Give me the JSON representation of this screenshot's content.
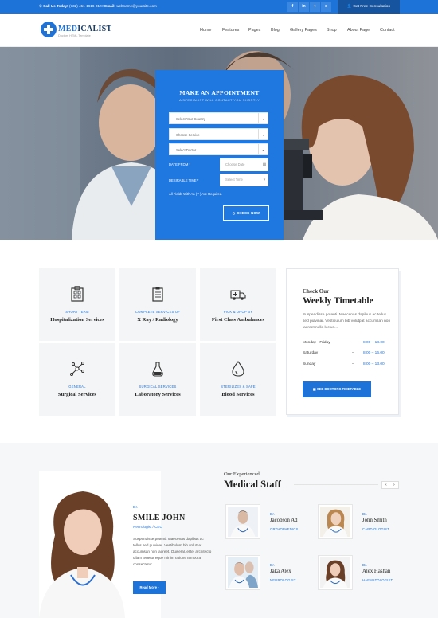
{
  "topbar": {
    "phone_label": "Call Us Today!",
    "phone": "(732) 451-1616-01",
    "email_label": "Email:",
    "email": "webname@yoursite.com",
    "social": [
      {
        "icon": "facebook-icon",
        "glyph": "f"
      },
      {
        "icon": "linkedin-icon",
        "glyph": "in"
      },
      {
        "icon": "twitter-icon",
        "glyph": "t"
      },
      {
        "icon": "skype-icon",
        "glyph": "s"
      }
    ],
    "cta": "Get Free Consultation"
  },
  "logo": {
    "part1": "MED",
    "part2": "ICALIST",
    "tagline": "Doctors HTML Template"
  },
  "nav": [
    "Home",
    "Features",
    "Pages",
    "Blog",
    "Gallery Pages",
    "Shop",
    "About Page",
    "Contact"
  ],
  "appointment": {
    "title": "MAKE AN APPOINTMENT",
    "subtitle": "A SPECIALIST WILL CONTACT YOU SHORTLY",
    "country_placeholder": "Select Your Country",
    "service_placeholder": "Choose Service",
    "doctor_placeholder": "Select Doctor",
    "date_label": "DATE FROM *",
    "date_placeholder": "Choose Date",
    "time_label": "DESIRABLE TIME *",
    "time_placeholder": "Select Time",
    "required_note": "All Fields With An ( * ) Are Required.",
    "submit": "CHECK NOW"
  },
  "services": [
    {
      "category": "SHORT TERM",
      "name": "Hospitalization Services",
      "icon": "hospital-icon"
    },
    {
      "category": "COMPLETE SERVICES OF",
      "name": "X Ray / Radiology",
      "icon": "clipboard-icon"
    },
    {
      "category": "PICK & DROP BY",
      "name": "First Class Ambulances",
      "icon": "ambulance-icon"
    },
    {
      "category": "GENERAL",
      "name": "Surgical Services",
      "icon": "molecule-icon"
    },
    {
      "category": "SURGICAL SERVICES",
      "name": "Laboratory Services",
      "icon": "flask-icon"
    },
    {
      "category": "STERILIZES & SAFE",
      "name": "Blood Services",
      "icon": "blood-drop-icon"
    }
  ],
  "timetable": {
    "pre": "Check Our",
    "title": "Weekly Timetable",
    "text": "Suspendisse potenti. Maecenas dapibus ac tellus sed pulvinar. Vestibulum bib volutpat accumsan non laoreet nulla luctus...",
    "rows": [
      {
        "day": "Monday - Friday",
        "dash": "–",
        "time": "8.00 – 18.00"
      },
      {
        "day": "Saturday",
        "dash": "–",
        "time": "8.00 – 16.00"
      },
      {
        "day": "Sunday",
        "dash": "–",
        "time": "8.00 – 13.00"
      }
    ],
    "button": "SEE DOCTORS TIMETABLE"
  },
  "featured_doctor": {
    "prefix": "Dr.",
    "name": "SMILE JOHN",
    "role": "Neurologist / CEO",
    "text": "Suspendisse potenti. Maecenas dapibus ac tellus sed pulvinar. Vestibulum bib volutpat accumsan non laoreet. Quiseral, elite, architecto ullam tenetur eque minim ratione tempora consectetur...",
    "button": "Read More"
  },
  "staff": {
    "pre": "Our Experienced",
    "title": "Medical Staff",
    "prev": "‹",
    "next": "›",
    "doctors": [
      {
        "prefix": "Dr.",
        "name": "Jacobson Ad",
        "role": "ORTHOPAEDICS"
      },
      {
        "prefix": "Dr.",
        "name": "John Smith",
        "role": "CARDIOLOGIST"
      },
      {
        "prefix": "Dr.",
        "name": "Jaka Alex",
        "role": "NEUROLOGIST"
      },
      {
        "prefix": "Dr.",
        "name": "Alex Hashan",
        "role": "HAEMATOLOGIST"
      }
    ]
  },
  "colors": {
    "accent": "#1e73d8",
    "dark_accent": "#16549f",
    "service_bg": "#f4f5f7"
  }
}
